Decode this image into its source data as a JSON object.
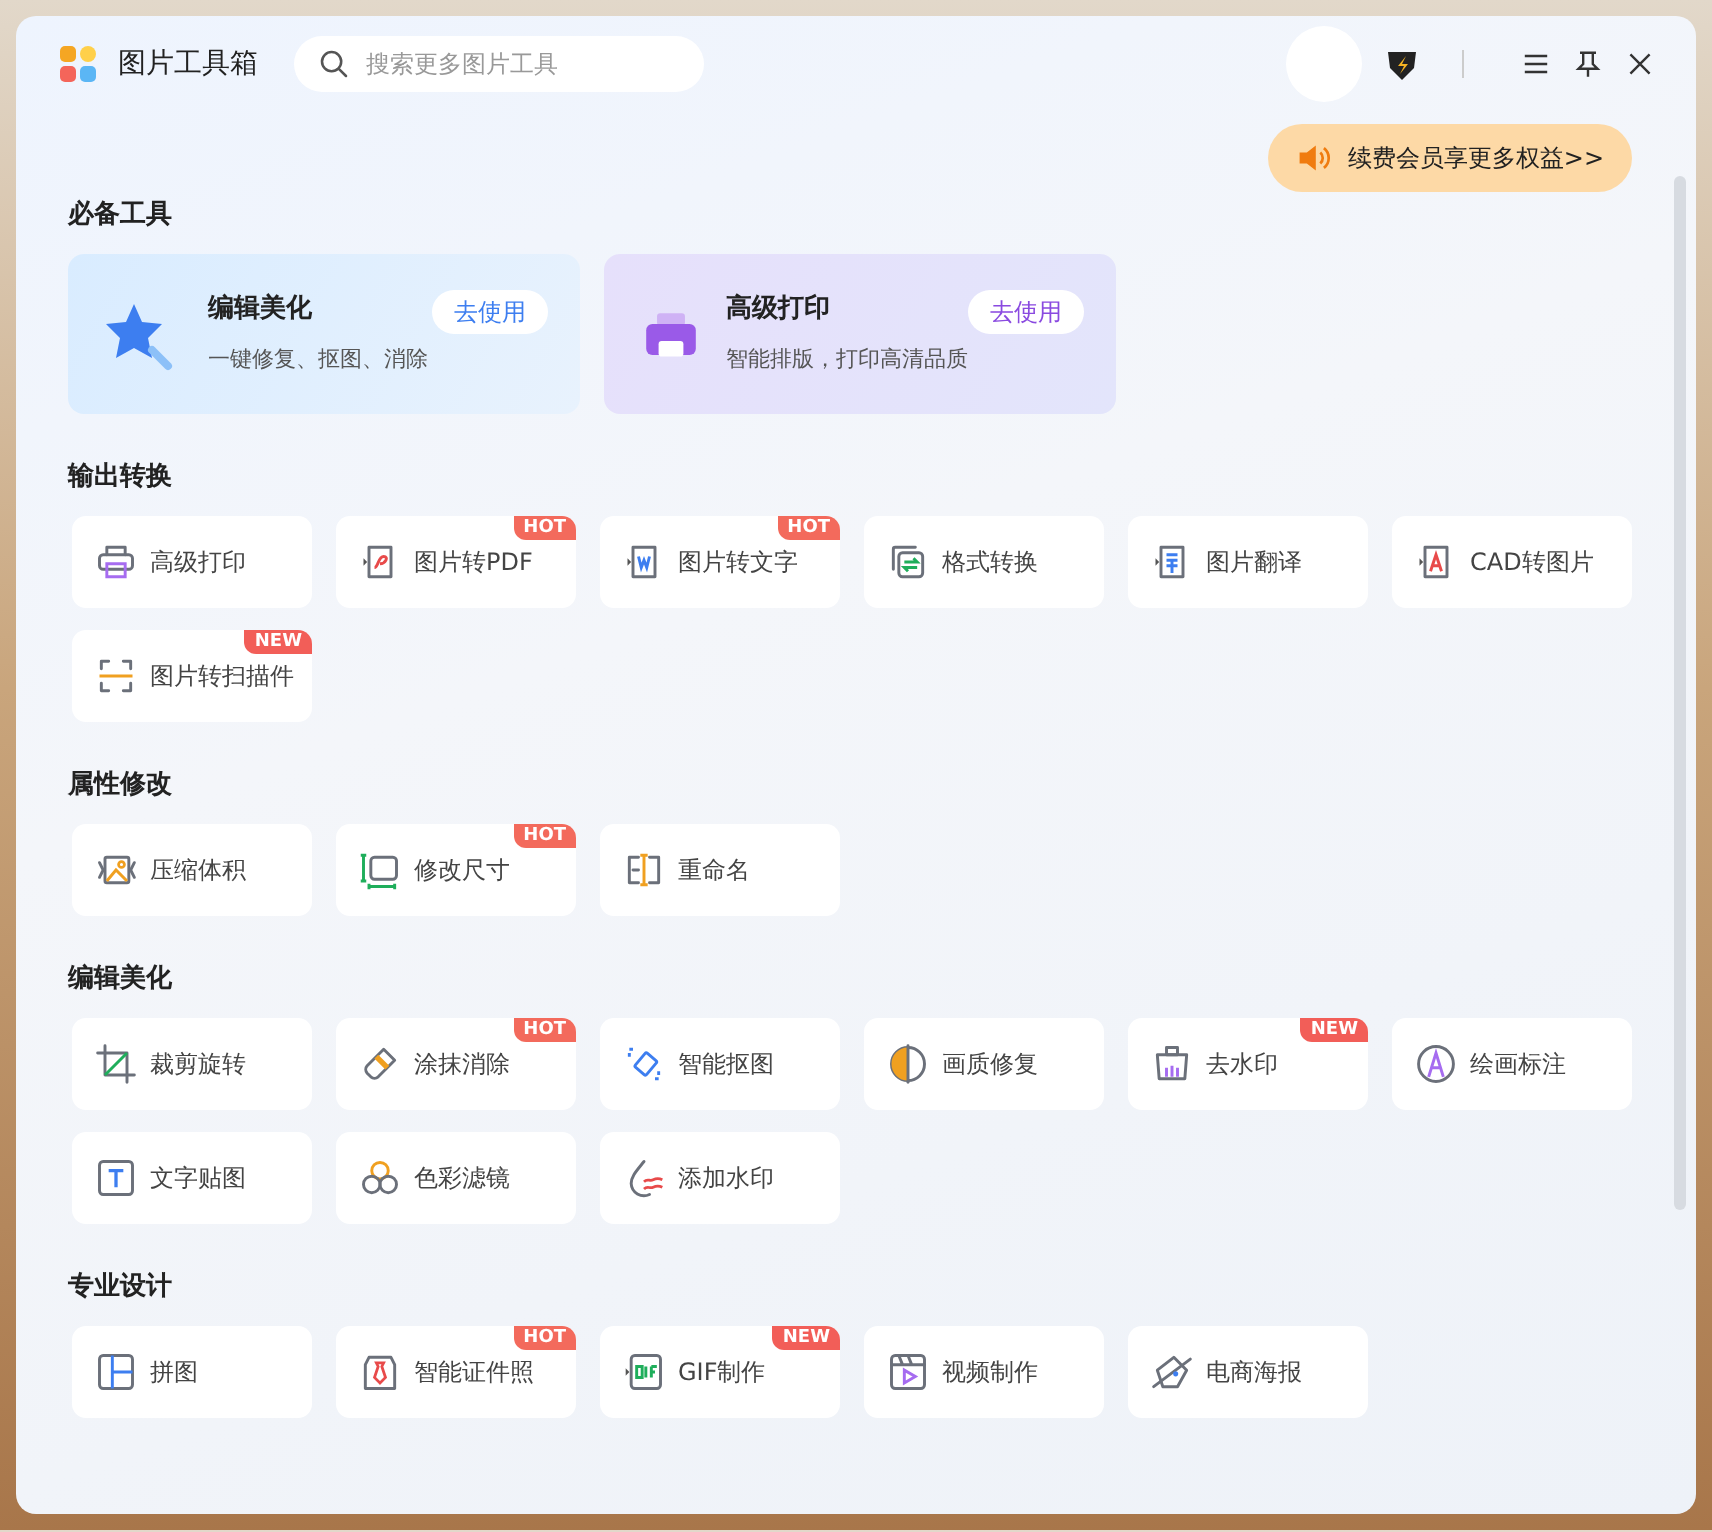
{
  "app": {
    "title": "图片工具箱"
  },
  "search": {
    "placeholder": "搜索更多图片工具"
  },
  "promo": {
    "label": "续费会员享更多权益>>"
  },
  "featured": {
    "heading": "必备工具",
    "cards": [
      {
        "title": "编辑美化",
        "subtitle": "一键修复、抠图、消除",
        "action": "去使用"
      },
      {
        "title": "高级打印",
        "subtitle": "智能排版，打印高清品质",
        "action": "去使用"
      }
    ]
  },
  "sections": [
    {
      "heading": "输出转换",
      "tools": [
        {
          "label": "高级打印"
        },
        {
          "label": "图片转PDF",
          "badge": "HOT"
        },
        {
          "label": "图片转文字",
          "badge": "HOT"
        },
        {
          "label": "格式转换"
        },
        {
          "label": "图片翻译"
        },
        {
          "label": "CAD转图片"
        },
        {
          "label": "图片转扫描件",
          "badge": "NEW"
        }
      ]
    },
    {
      "heading": "属性修改",
      "tools": [
        {
          "label": "压缩体积"
        },
        {
          "label": "修改尺寸",
          "badge": "HOT"
        },
        {
          "label": "重命名"
        }
      ]
    },
    {
      "heading": "编辑美化",
      "tools": [
        {
          "label": "裁剪旋转"
        },
        {
          "label": "涂抹消除",
          "badge": "HOT"
        },
        {
          "label": "智能抠图"
        },
        {
          "label": "画质修复"
        },
        {
          "label": "去水印",
          "badge": "NEW"
        },
        {
          "label": "绘画标注"
        },
        {
          "label": "文字贴图"
        },
        {
          "label": "色彩滤镜"
        },
        {
          "label": "添加水印"
        }
      ]
    },
    {
      "heading": "专业设计",
      "tools": [
        {
          "label": "拼图"
        },
        {
          "label": "智能证件照",
          "badge": "HOT"
        },
        {
          "label": "GIF制作",
          "badge": "NEW"
        },
        {
          "label": "视频制作"
        },
        {
          "label": "电商海报"
        }
      ]
    }
  ]
}
